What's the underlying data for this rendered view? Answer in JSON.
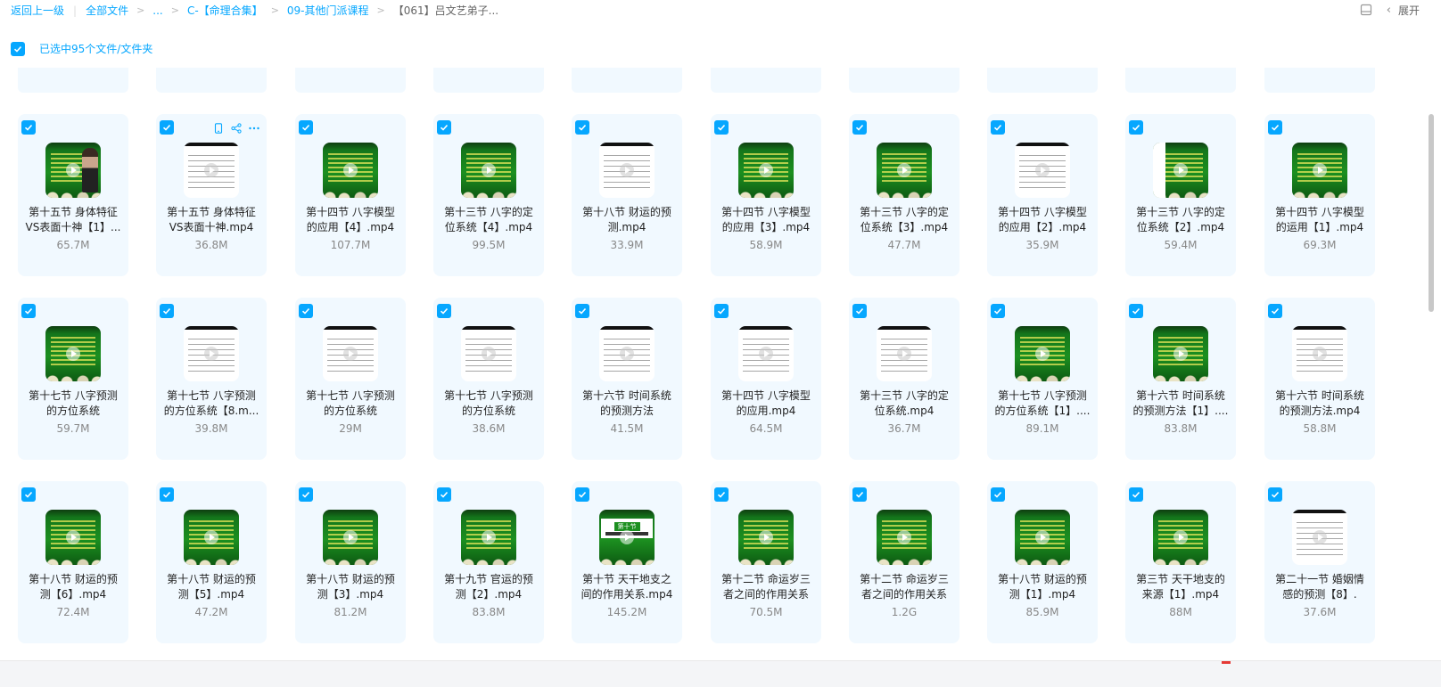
{
  "breadcrumb": {
    "back": "返回上一级",
    "items": [
      "全部文件",
      "...",
      "C-【命理合集】",
      "09-其他门派课程"
    ],
    "current": "【061】吕文艺弟子..."
  },
  "topbar": {
    "expand_label": "展开"
  },
  "selection": {
    "text": "已选中95个文件/文件夹"
  },
  "colors": {
    "accent": "#06a7ff",
    "card_bg": "#f1f9ff"
  },
  "rows": [
    [
      {
        "name": "第十五节 身体特征VS表面十神【1】...",
        "size": "65.7M",
        "thumb": "green-figure"
      },
      {
        "name": "第十五节 身体特征VS表面十神.mp4",
        "size": "36.8M",
        "thumb": "white"
      },
      {
        "name": "第十四节 八字模型的应用【4】.mp4",
        "size": "107.7M",
        "thumb": "green"
      },
      {
        "name": "第十三节 八字的定位系统【4】.mp4",
        "size": "99.5M",
        "thumb": "green"
      },
      {
        "name": "第十八节 财运的预测.mp4",
        "size": "33.9M",
        "thumb": "white"
      },
      {
        "name": "第十四节 八字模型的应用【3】.mp4",
        "size": "58.9M",
        "thumb": "green"
      },
      {
        "name": "第十三节 八字的定位系统【3】.mp4",
        "size": "47.7M",
        "thumb": "green"
      },
      {
        "name": "第十四节 八字模型的应用【2】.mp4",
        "size": "35.9M",
        "thumb": "white"
      },
      {
        "name": "第十三节 八字的定位系统【2】.mp4",
        "size": "59.4M",
        "thumb": "green-split"
      },
      {
        "name": "第十四节 八字模型的运用【1】.mp4",
        "size": "69.3M",
        "thumb": "green"
      }
    ],
    [
      {
        "name": "第十七节 八字预测的方位系统",
        "size": "59.7M",
        "thumb": "green"
      },
      {
        "name": "第十七节 八字预测的方位系统【8.m...",
        "size": "39.8M",
        "thumb": "white"
      },
      {
        "name": "第十七节 八字预测的方位系统",
        "size": "29M",
        "thumb": "white"
      },
      {
        "name": "第十七节 八字预测的方位系统",
        "size": "38.6M",
        "thumb": "white"
      },
      {
        "name": "第十六节 时间系统的预测方法",
        "size": "41.5M",
        "thumb": "white"
      },
      {
        "name": "第十四节 八字模型的应用.mp4",
        "size": "64.5M",
        "thumb": "white"
      },
      {
        "name": "第十三节 八字的定位系统.mp4",
        "size": "36.7M",
        "thumb": "white"
      },
      {
        "name": "第十七节 八字预测的方位系统【1】....",
        "size": "89.1M",
        "thumb": "green"
      },
      {
        "name": "第十六节 时间系统的预测方法【1】....",
        "size": "83.8M",
        "thumb": "green"
      },
      {
        "name": "第十六节 时间系统的预测方法.mp4",
        "size": "58.8M",
        "thumb": "white"
      }
    ],
    [
      {
        "name": "第十八节 财运的预测【6】.mp4",
        "size": "72.4M",
        "thumb": "green"
      },
      {
        "name": "第十八节 财运的预测【5】.mp4",
        "size": "47.2M",
        "thumb": "green"
      },
      {
        "name": "第十八节 财运的预测【3】.mp4",
        "size": "81.2M",
        "thumb": "green"
      },
      {
        "name": "第十九节 官运的预测【2】.mp4",
        "size": "83.8M",
        "thumb": "green"
      },
      {
        "name": "第十节 天干地支之间的作用关系.mp4",
        "size": "145.2M",
        "thumb": "slide"
      },
      {
        "name": "第十二节 命运岁三者之间的作用关系",
        "size": "70.5M",
        "thumb": "green"
      },
      {
        "name": "第十二节 命运岁三者之间的作用关系",
        "size": "1.2G",
        "thumb": "green"
      },
      {
        "name": "第十八节 财运的预测【1】.mp4",
        "size": "85.9M",
        "thumb": "green"
      },
      {
        "name": "第三节 天干地支的来源【1】.mp4",
        "size": "88M",
        "thumb": "green"
      },
      {
        "name": "第二十一节 婚姻情感的预测【8】.",
        "size": "37.6M",
        "thumb": "white"
      }
    ]
  ],
  "slide_thumb_text": "第十节"
}
